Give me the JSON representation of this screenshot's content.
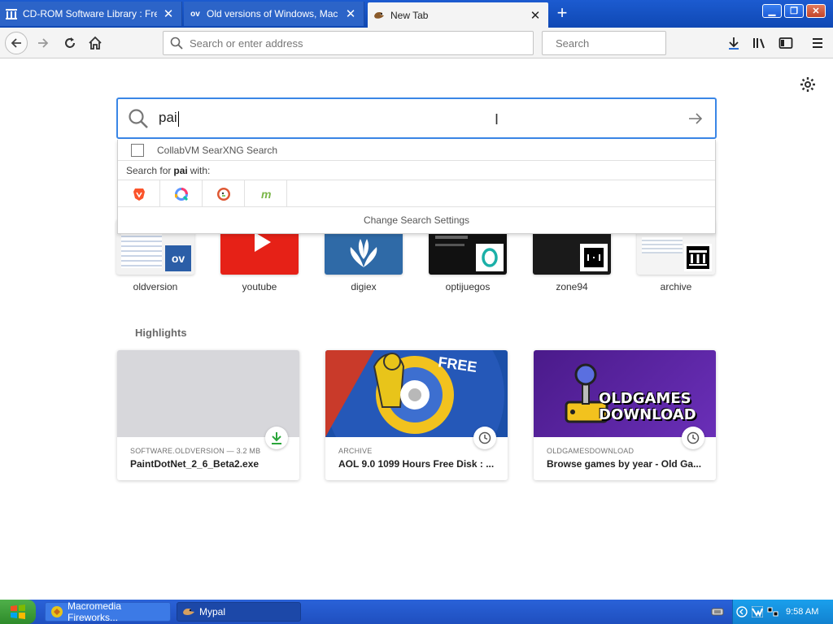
{
  "tabs": [
    {
      "title": "CD-ROM Software Library : Free S",
      "favicon": "archive-icon",
      "active": false
    },
    {
      "title": "Old versions of Windows, Mac and",
      "favicon": "ov-icon",
      "active": false
    },
    {
      "title": "New Tab",
      "favicon": "firefox-icon",
      "active": true
    }
  ],
  "window_controls": {
    "minimize": "minimize-icon",
    "maximize": "maximize-icon",
    "close": "close-icon"
  },
  "navbar": {
    "address_placeholder": "Search or enter address",
    "search_placeholder": "Search"
  },
  "newtab_search": {
    "query": "pai"
  },
  "dropdown": {
    "suggestion": "CollabVM SearXNG Search",
    "search_for_prefix": "Search for",
    "search_for_term": "pai",
    "search_for_suffix": "with:",
    "engines": [
      "brave-icon",
      "qwant-icon",
      "duckduckgo-icon",
      "mojeek-icon"
    ],
    "settings_label": "Change Search Settings"
  },
  "topsites": [
    {
      "label": "oldversion"
    },
    {
      "label": "youtube"
    },
    {
      "label": "digiex"
    },
    {
      "label": "optijuegos"
    },
    {
      "label": "zone94"
    },
    {
      "label": "archive"
    }
  ],
  "highlights": {
    "title": "Highlights",
    "cards": [
      {
        "source": "SOFTWARE.OLDVERSION — 3.2 MB",
        "title": "PaintDotNet_2_6_Beta2.exe",
        "badge": "download-icon"
      },
      {
        "source": "ARCHIVE",
        "title": "AOL 9.0 1099 Hours Free Disk : ...",
        "badge": "clock-icon"
      },
      {
        "source": "OLDGAMESDOWNLOAD",
        "title": "Browse games by year - Old Ga...",
        "badge": "clock-icon"
      }
    ],
    "oldgames_logo_line1": "OLDGAMES",
    "oldgames_logo_line2": "DOWNLOAD"
  },
  "taskbar": {
    "tasks": [
      {
        "label": "Macromedia Fireworks..."
      },
      {
        "label": "Mypal"
      }
    ],
    "clock": "9:58 AM"
  },
  "colors": {
    "accent": "#3a86e6",
    "titlebar": "#1c5bd0",
    "taskbar": "#2a62d8"
  }
}
